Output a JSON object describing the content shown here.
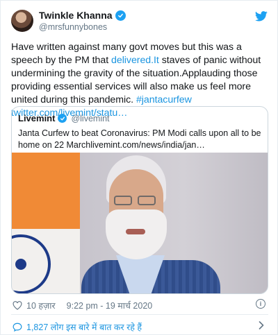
{
  "author": {
    "display_name": "Twinkle Khanna",
    "handle": "@mrsfunnybones"
  },
  "tweet": {
    "text_part1": "Have written against many govt moves but this was a speech by the PM that ",
    "link_delivered": "delivered.It",
    "text_part2": " staves of panic without undermining the gravity of the situation.Applauding those providing essential services will also make us feel more united during this pandemic. ",
    "hashtag": "#jantacurfew",
    "url": "twitter.com/livemint/statu…"
  },
  "quoted_tweet": {
    "display_name": "Livemint",
    "handle": "@livemint",
    "text": "Janta Curfew to beat Coronavirus: PM Modi calls upon all to be home on 22 Marchlivemint.com/news/india/jan…"
  },
  "meta": {
    "likes": "10 हज़ार",
    "time": "9:22 pm - 19 मार्च 2020"
  },
  "conversation": {
    "label": "1,827 लोग इस बारे में बात कर रहे हैं"
  },
  "icons": {
    "verified": "verified-badge-icon",
    "brand": "twitter-bird-icon",
    "like": "heart-icon",
    "info": "info-icon",
    "reply": "chat-bubble-icon",
    "more": "chevron-right-icon"
  },
  "colors": {
    "link": "#1b95e0",
    "verified": "#1da1f2",
    "text": "#14171a",
    "secondary": "#657786",
    "border": "#e6ecf0"
  }
}
